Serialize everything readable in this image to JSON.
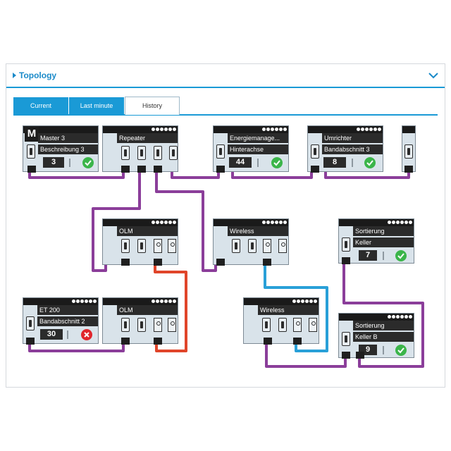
{
  "panel": {
    "title": "Topology",
    "collapse_icon": "chevron-down-icon"
  },
  "tabs": [
    {
      "label": "Current",
      "active": false
    },
    {
      "label": "Last minute",
      "active": false
    },
    {
      "label": "History",
      "active": true
    }
  ],
  "colors": {
    "accent": "#1a9ad6",
    "profinet": "#8b3e9a",
    "fiber": "#e0452a",
    "wireless": "#29a0d8",
    "ok": "#3bb54a",
    "error": "#e0262c"
  },
  "devices": {
    "master": {
      "mark": "M",
      "name": "Master 3",
      "desc": "Beschreibung 3",
      "number": "3",
      "status": "ok"
    },
    "repeater": {
      "name": "Repeater"
    },
    "energy": {
      "name": "Energiemanage...",
      "desc": "Hinterachse",
      "number": "44",
      "status": "ok"
    },
    "umrichter": {
      "name": "Umrichter",
      "desc": "Bandabschnitt 3",
      "number": "8",
      "status": "ok"
    },
    "olm_upper": {
      "name": "OLM"
    },
    "wireless_upper": {
      "name": "Wireless"
    },
    "sortierung_keller": {
      "name": "Sortierung",
      "desc": "Keller",
      "number": "7",
      "status": "ok"
    },
    "et200": {
      "name": "ET 200",
      "desc": "Bandabschnitt 2",
      "number": "30",
      "status": "error"
    },
    "olm_lower": {
      "name": "OLM"
    },
    "wireless_lower": {
      "name": "Wireless"
    },
    "sortierung_kellerb": {
      "name": "Sortierung",
      "desc": "Keller B",
      "number": "9",
      "status": "ok"
    }
  }
}
